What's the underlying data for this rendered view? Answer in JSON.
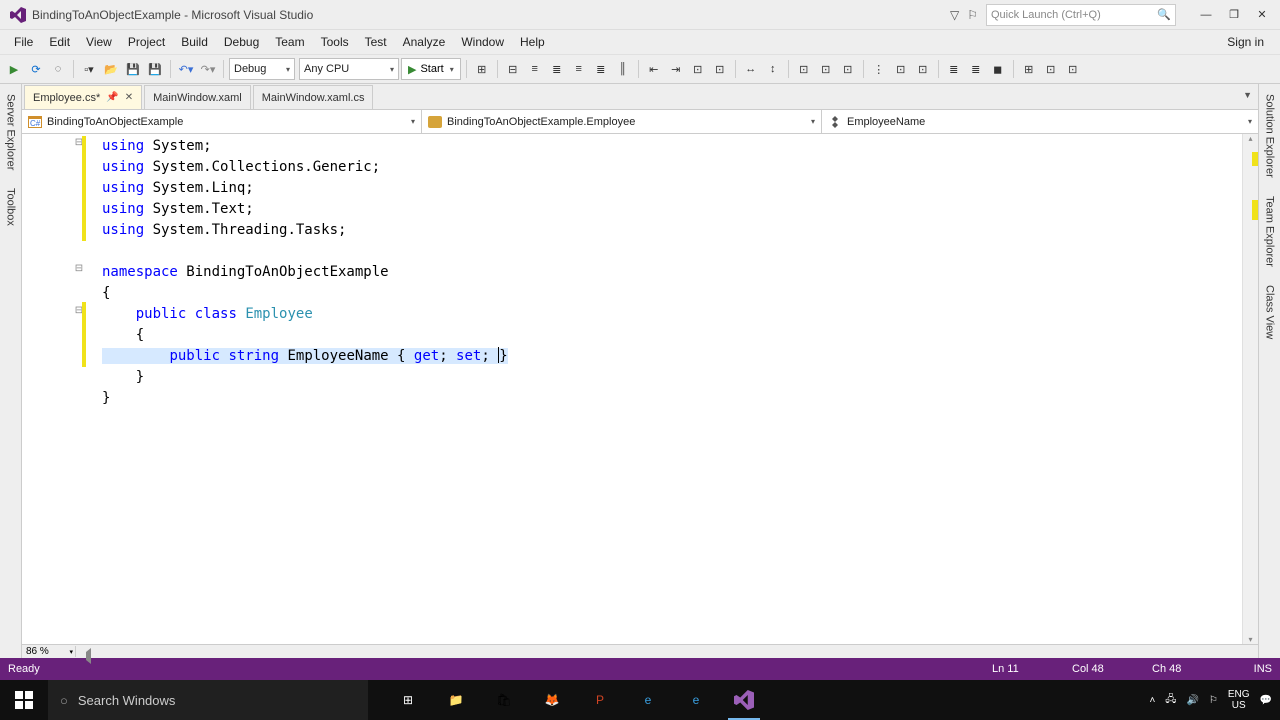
{
  "title": "BindingToAnObjectExample - Microsoft Visual Studio",
  "search_placeholder": "Quick Launch (Ctrl+Q)",
  "signin": "Sign in",
  "menu": [
    "File",
    "Edit",
    "View",
    "Project",
    "Build",
    "Debug",
    "Team",
    "Tools",
    "Test",
    "Analyze",
    "Window",
    "Help"
  ],
  "config": "Debug",
  "platform": "Any CPU",
  "start": "Start",
  "tabs": [
    {
      "label": "Employee.cs*",
      "active": true,
      "pinned": true
    },
    {
      "label": "MainWindow.xaml",
      "active": false
    },
    {
      "label": "MainWindow.xaml.cs",
      "active": false
    }
  ],
  "nav": {
    "project": "BindingToAnObjectExample",
    "class": "BindingToAnObjectExample.Employee",
    "member": "EmployeeName"
  },
  "left_tabs": [
    "Server Explorer",
    "Toolbox"
  ],
  "right_tabs": [
    "Solution Explorer",
    "Team Explorer",
    "Class View"
  ],
  "code": {
    "l1": {
      "kw": "using",
      "ns": " System;"
    },
    "l2": {
      "kw": "using",
      "ns": " System.Collections.Generic;"
    },
    "l3": {
      "kw": "using",
      "ns": " System.Linq;"
    },
    "l4": {
      "kw": "using",
      "ns": " System.Text;"
    },
    "l5": {
      "kw": "using",
      "ns": " System.Threading.Tasks;"
    },
    "l7": {
      "kw": "namespace",
      "ns": " BindingToAnObjectExample"
    },
    "l8": "{",
    "l9a": "public",
    "l9b": "class",
    "l9c": "Employee",
    "l10": "    {",
    "l11a": "public",
    "l11b": "string",
    "l11c": " EmployeeName { ",
    "l11d": "get",
    "l11e": "; ",
    "l11f": "set",
    "l11g": "; ",
    "l11h": "}",
    "l12": "    }",
    "l13": "}"
  },
  "zoom": "86 %",
  "status": {
    "ready": "Ready",
    "ln": "Ln 11",
    "col": "Col 48",
    "ch": "Ch 48",
    "ins": "INS"
  },
  "taskbar_search": "Search Windows",
  "tray": {
    "lang": "ENG",
    "region": "US"
  }
}
